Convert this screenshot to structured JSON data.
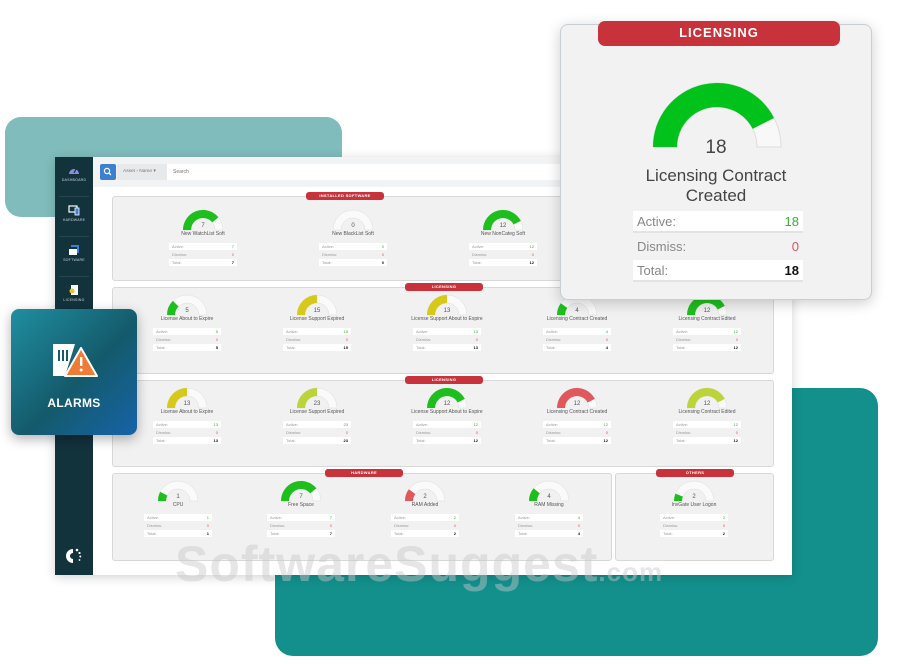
{
  "sidebar": {
    "items": [
      {
        "label": "DASHBOARD",
        "icon": "dashboard-gauge-icon"
      },
      {
        "label": "HARDWARE",
        "icon": "devices-icon"
      },
      {
        "label": "SOFTWARE",
        "icon": "software-window-icon"
      },
      {
        "label": "LICENSING",
        "icon": "license-icon"
      }
    ]
  },
  "topbar": {
    "asset_filter": "Asset › Name ▾",
    "search_placeholder": "Search"
  },
  "colors": {
    "green": "#1dbf1d",
    "yellow": "#d6c91a",
    "lime": "#bcd43a",
    "red": "#e0575c",
    "ribbon": "#c8323a",
    "accent_blue": "#3d7fd1"
  },
  "labels": {
    "active": "Active:",
    "dismiss": "Dismiss:",
    "total": "Total:"
  },
  "sections": [
    {
      "title": "INSTALLED SOFTWARE",
      "widgets": [
        {
          "name": "New WatchList Soft",
          "value": 7,
          "active": 7,
          "dismiss": 0,
          "total": 7,
          "fill": 0.78,
          "color": "#1dbf1d"
        },
        {
          "name": "New BlackList Soft",
          "value": 0,
          "active": 0,
          "dismiss": 0,
          "total": 0,
          "fill": 0,
          "color": "#1dbf1d"
        },
        {
          "name": "New NonCateg Soft",
          "value": 12,
          "active": 12,
          "dismiss": 0,
          "total": 12,
          "fill": 0.85,
          "color": "#1dbf1d"
        }
      ]
    },
    {
      "title": "LICENSING",
      "widgets": [
        {
          "name": "License About to Expire",
          "value": 5,
          "active": 5,
          "dismiss": 0,
          "total": 5,
          "fill": 0.25,
          "color": "#1dbf1d"
        },
        {
          "name": "License Support Expired",
          "value": 15,
          "active": 15,
          "dismiss": 0,
          "total": 15,
          "fill": 0.5,
          "color": "#d6c91a"
        },
        {
          "name": "License Support About to Expire",
          "value": 13,
          "active": 13,
          "dismiss": 0,
          "total": 13,
          "fill": 0.5,
          "color": "#d6c91a"
        },
        {
          "name": "Licensing Contract Created",
          "value": 4,
          "active": 4,
          "dismiss": 0,
          "total": 4,
          "fill": 0.2,
          "color": "#1dbf1d"
        },
        {
          "name": "Licensing Contract Edited",
          "value": 12,
          "active": 12,
          "dismiss": 0,
          "total": 12,
          "fill": 0.85,
          "color": "#1dbf1d"
        }
      ]
    },
    {
      "title": "LICENSING",
      "widgets": [
        {
          "name": "License About to Expire",
          "value": 13,
          "active": 13,
          "dismiss": 0,
          "total": 13,
          "fill": 0.5,
          "color": "#d6c91a"
        },
        {
          "name": "License Support Expired",
          "value": 23,
          "active": 23,
          "dismiss": 0,
          "total": 23,
          "fill": 0.5,
          "color": "#bcd43a"
        },
        {
          "name": "License Support About to Expire",
          "value": 12,
          "active": 12,
          "dismiss": 0,
          "total": 12,
          "fill": 0.85,
          "color": "#1dbf1d"
        },
        {
          "name": "Licensing Contract Created",
          "value": 12,
          "active": 12,
          "dismiss": 0,
          "total": 12,
          "fill": 0.85,
          "color": "#e0575c"
        },
        {
          "name": "Licensing Contract Edited",
          "value": 12,
          "active": 12,
          "dismiss": 0,
          "total": 12,
          "fill": 0.85,
          "color": "#bcd43a"
        }
      ]
    },
    {
      "title": "HARDWARE",
      "widgets": [
        {
          "name": "CPU",
          "value": 1,
          "active": 1,
          "dismiss": 0,
          "total": 1,
          "fill": 0.15,
          "color": "#1dbf1d"
        },
        {
          "name": "Free Space",
          "value": 7,
          "active": 7,
          "dismiss": 0,
          "total": 7,
          "fill": 0.78,
          "color": "#1dbf1d"
        },
        {
          "name": "RAM Added",
          "value": 2,
          "active": 2,
          "dismiss": 0,
          "total": 2,
          "fill": 0.2,
          "color": "#e0575c"
        },
        {
          "name": "RAM Missing",
          "value": 4,
          "active": 4,
          "dismiss": 0,
          "total": 4,
          "fill": 0.22,
          "color": "#1dbf1d"
        }
      ]
    },
    {
      "title": "OTHERS",
      "widgets": [
        {
          "name": "InvGate User Logon",
          "value": 2,
          "active": 2,
          "dismiss": 0,
          "total": 2,
          "fill": 0.12,
          "color": "#1dbf1d"
        }
      ]
    }
  ],
  "alarms_tile": {
    "label": "ALARMS",
    "icon": "alarm-warning-icon"
  },
  "zoom_card": {
    "ribbon": "LICENSING",
    "value": "18",
    "title_line1": "Licensing Contract",
    "title_line2": "Created",
    "active_label": "Active:",
    "active_value": "18",
    "dismiss_label": "Dismiss:",
    "dismiss_value": "0",
    "total_label": "Total:",
    "total_value": "18",
    "fill": 0.85,
    "color": "#00c21a"
  },
  "watermark": {
    "text": "SoftwareSuggest",
    "suffix": ".com"
  }
}
